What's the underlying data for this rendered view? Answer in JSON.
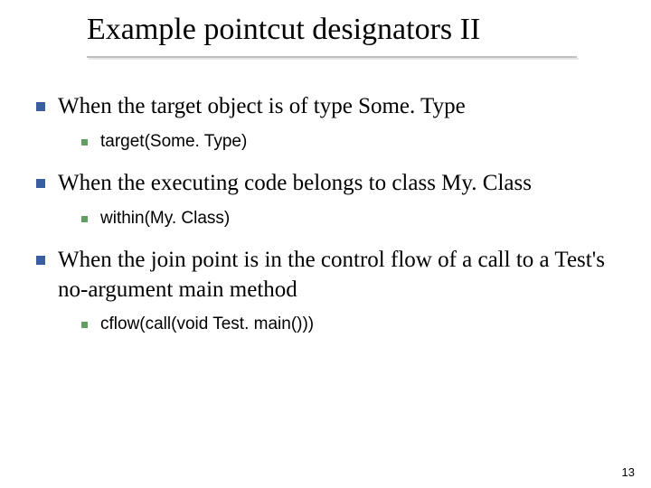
{
  "title": "Example pointcut designators II",
  "bullets": [
    {
      "text": "When the target object is of type Some. Type",
      "sub": {
        "text": "target(Some. Type)"
      }
    },
    {
      "text": "When the executing code belongs to class My. Class",
      "sub": {
        "text": "within(My. Class)"
      }
    },
    {
      "text": "When the join point is in the control flow of a call to a Test's no-argument main method",
      "sub": {
        "text": "cflow(call(void Test. main()))"
      }
    }
  ],
  "page_number": "13"
}
